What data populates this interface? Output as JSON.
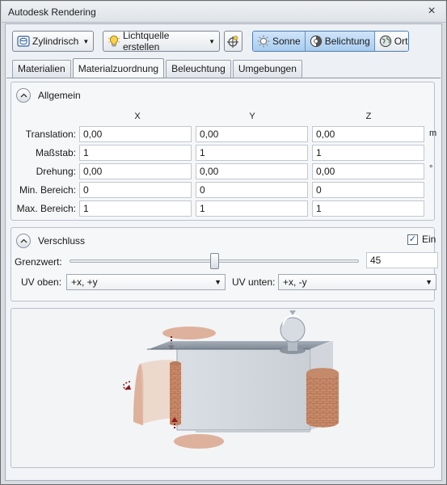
{
  "window": {
    "title": "Autodesk Rendering",
    "close_glyph": "×"
  },
  "toolbar": {
    "mapping_button": {
      "label": "Zylindrisch",
      "icon": "cylinder-mapping-icon"
    },
    "light_button": {
      "label": "Lichtquelle erstellen",
      "icon": "lightbulb-icon"
    },
    "target_button": {
      "icon": "light-target-icon"
    },
    "toggles": [
      {
        "label": "Sonne",
        "icon": "sun-icon",
        "pressed": true
      },
      {
        "label": "Belichtung",
        "icon": "exposure-icon",
        "pressed": true
      },
      {
        "label": "Ort",
        "icon": "globe-icon",
        "pressed": false
      }
    ]
  },
  "tabs": [
    {
      "label": "Materialien",
      "active": false
    },
    {
      "label": "Materialzuordnung",
      "active": true
    },
    {
      "label": "Beleuchtung",
      "active": false
    },
    {
      "label": "Umgebungen",
      "active": false
    }
  ],
  "allgemein": {
    "title": "Allgemein",
    "columns": [
      "X",
      "Y",
      "Z"
    ],
    "rows": [
      {
        "label": "Translation:",
        "values": [
          "0,00",
          "0,00",
          "0,00"
        ],
        "unit": "m"
      },
      {
        "label": "Maßstab:",
        "values": [
          "1",
          "1",
          "1"
        ],
        "unit": ""
      },
      {
        "label": "Drehung:",
        "values": [
          "0,00",
          "0,00",
          "0,00"
        ],
        "unit": "°"
      },
      {
        "label": "Min. Bereich:",
        "values": [
          "0",
          "0",
          "0"
        ],
        "unit": ""
      },
      {
        "label": "Max. Bereich:",
        "values": [
          "1",
          "1",
          "1"
        ],
        "unit": ""
      }
    ]
  },
  "verschluss": {
    "title": "Verschluss",
    "enabled_label": "Ein",
    "enabled": true,
    "threshold_label": "Grenzwert:",
    "threshold_value": "45",
    "threshold_fraction": 0.5,
    "uv_top_label": "UV oben:",
    "uv_top_value": "+x, +y",
    "uv_bottom_label": "UV unten:",
    "uv_bottom_value": "+x, -y"
  },
  "colors": {
    "accent_pressed": "#a9cdef",
    "texture_brick": "#c98b6a",
    "arrow_red": "#8b1a1a"
  }
}
